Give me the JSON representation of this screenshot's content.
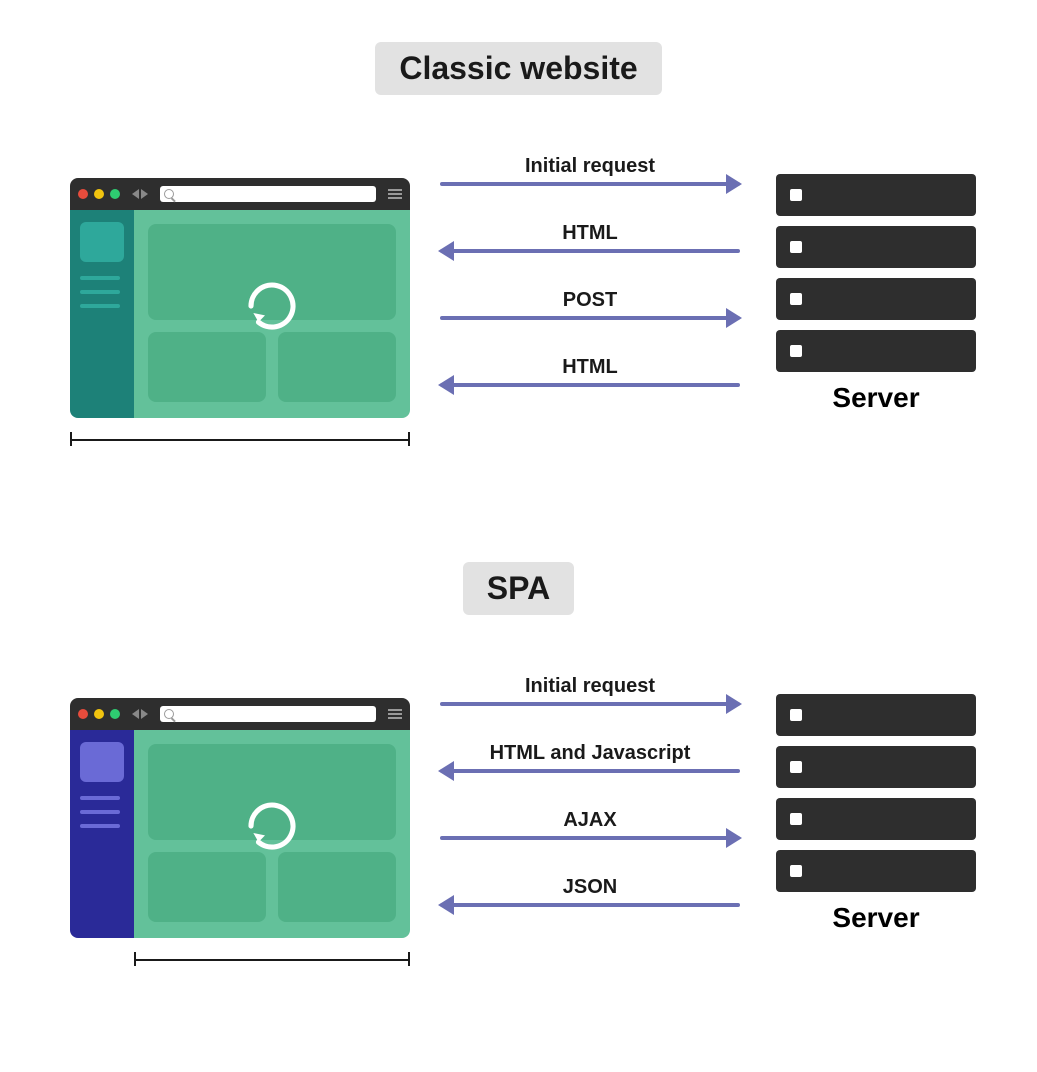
{
  "diagram": {
    "sections": [
      {
        "id": "classic",
        "title": "Classic website",
        "browser_theme": "teal",
        "arrows": [
          {
            "label": "Initial request",
            "direction": "right"
          },
          {
            "label": "HTML",
            "direction": "left"
          },
          {
            "label": "POST",
            "direction": "right"
          },
          {
            "label": "HTML",
            "direction": "left"
          }
        ],
        "server_label": "Server",
        "bracket": "full"
      },
      {
        "id": "spa",
        "title": "SPA",
        "browser_theme": "indigo",
        "arrows": [
          {
            "label": "Initial request",
            "direction": "right"
          },
          {
            "label": "HTML and Javascript",
            "direction": "left"
          },
          {
            "label": "AJAX",
            "direction": "right"
          },
          {
            "label": "JSON",
            "direction": "left"
          }
        ],
        "server_label": "Server",
        "bracket": "partial"
      }
    ]
  }
}
